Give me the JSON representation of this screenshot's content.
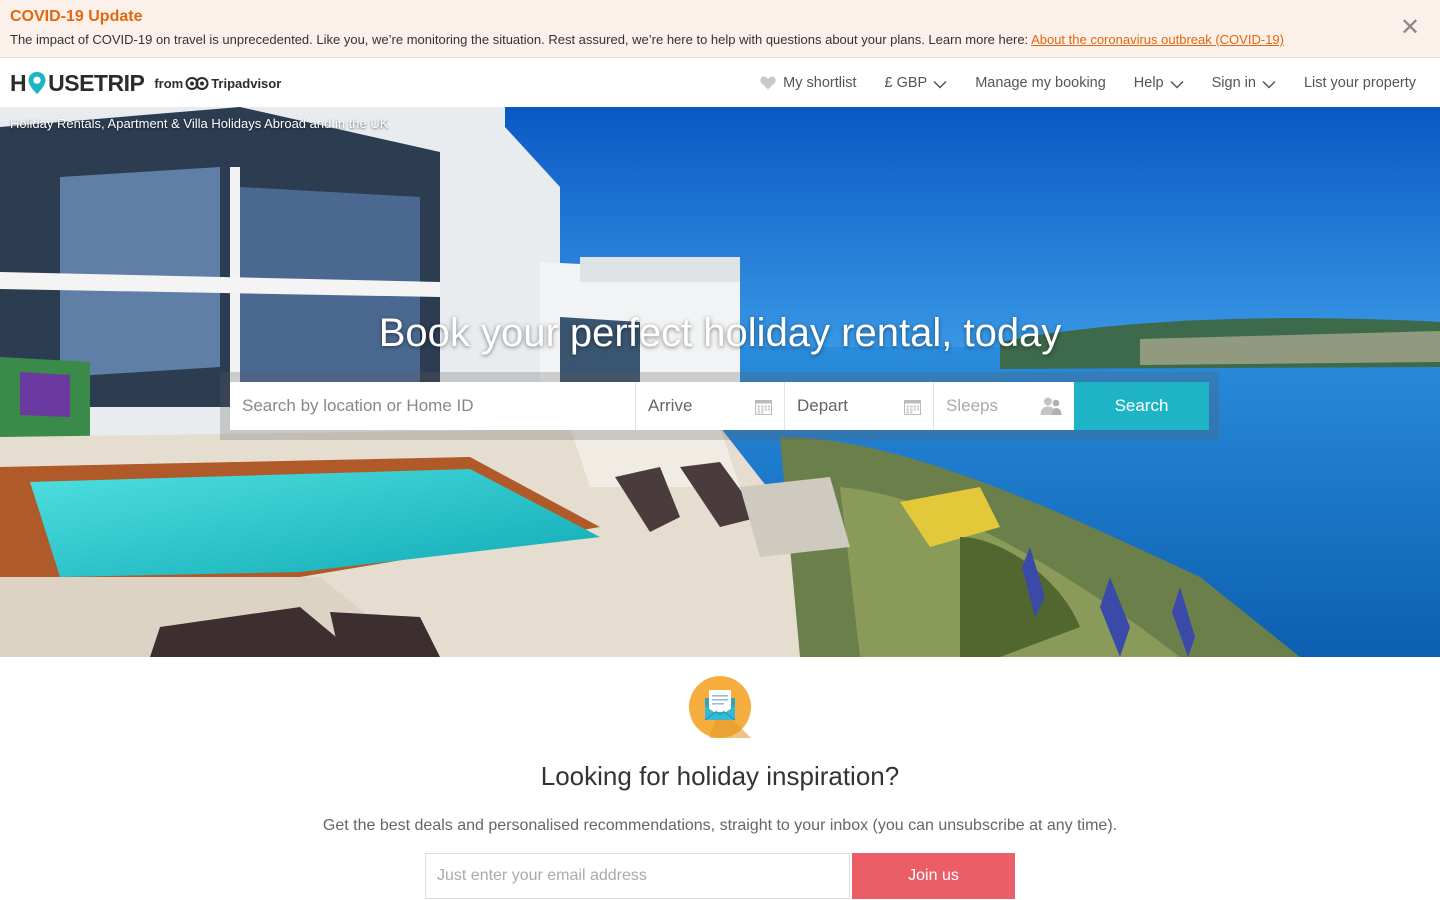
{
  "covid": {
    "title": "COVID-19 Update",
    "message": "The impact of COVID-19 on travel is unprecedented. Like you, we’re monitoring the situation. Rest assured, we’re here to help with questions about your plans. Learn more here: ",
    "link_text": "About the coronavirus outbreak (COVID-19)",
    "close_icon": "close-icon",
    "close_glyph": "✕"
  },
  "header": {
    "logo": {
      "left": "H",
      "right": "USETRIP",
      "from": "from",
      "partner": "Tripadvisor"
    },
    "nav": {
      "shortlist": "My shortlist",
      "currency": "£ GBP",
      "manage": "Manage my booking",
      "help": "Help",
      "signin": "Sign in",
      "list_property": "List your property"
    }
  },
  "hero": {
    "caption": "Holiday Rentals, Apartment & Villa Holidays Abroad and in the UK",
    "title": "Book your perfect holiday rental, today",
    "search": {
      "location_placeholder": "Search by location or Home ID",
      "arrive": "Arrive",
      "depart": "Depart",
      "sleeps": "Sleeps",
      "button": "Search"
    }
  },
  "newsletter": {
    "icon": "envelope-icon",
    "title": "Looking for holiday inspiration?",
    "subtitle": "Get the best deals and personalised recommendations, straight to your inbox (you can unsubscribe at any time).",
    "email_placeholder": "Just enter your email address",
    "button": "Join us"
  },
  "colors": {
    "accent_orange": "#e2670e",
    "search_teal": "#1fb4c5",
    "join_red": "#eb5d67",
    "banner_bg": "#fbf1ea"
  }
}
